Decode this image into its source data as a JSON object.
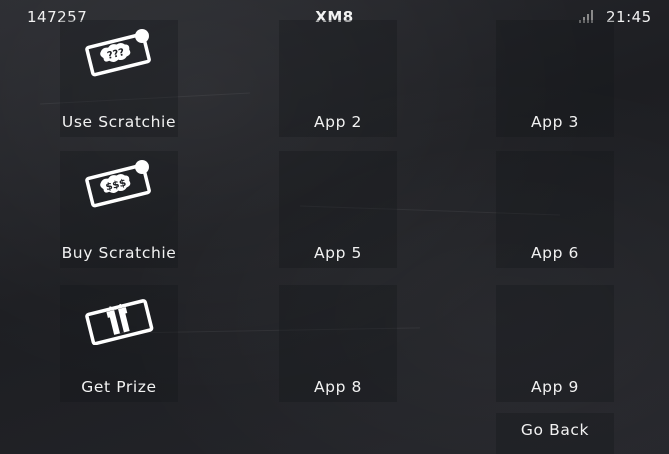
{
  "status_bar": {
    "left_text": "147257",
    "title": "XM8",
    "time": "21:45",
    "signal_icon": "signal-bars-icon"
  },
  "apps": [
    {
      "label": "Use Scratchie",
      "icon": "scratch-ticket-question-icon"
    },
    {
      "label": "App 2"
    },
    {
      "label": "App 3"
    },
    {
      "label": "Buy Scratchie",
      "icon": "scratch-ticket-dollar-icon"
    },
    {
      "label": "App 5"
    },
    {
      "label": "App 6"
    },
    {
      "label": "Get Prize",
      "icon": "gift-ticket-icon"
    },
    {
      "label": "App 8"
    },
    {
      "label": "App 9"
    }
  ],
  "icon_text": {
    "use": "???",
    "buy": "$$$"
  },
  "footer": {
    "back_label": "Go Back"
  },
  "colors": {
    "text": "#f2f2f2",
    "background": "#1c1d21"
  }
}
